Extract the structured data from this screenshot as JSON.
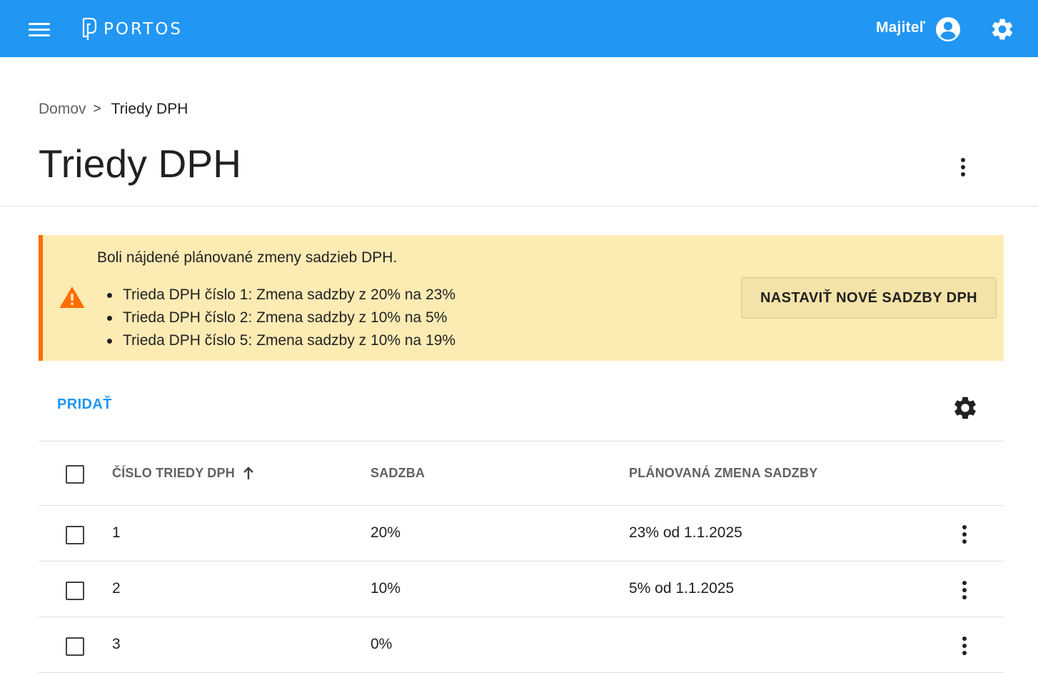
{
  "app": {
    "brand": "PORTOS",
    "user_label": "Majiteľ",
    "brand_color": "#2196f3",
    "icons": [
      "menu-icon",
      "portos-logo-icon",
      "account-circle-icon",
      "gear-icon"
    ]
  },
  "breadcrumb": {
    "home": "Domov",
    "separator": ">",
    "current": "Triedy DPH"
  },
  "page": {
    "title": "Triedy DPH"
  },
  "alert": {
    "title": "Boli nájdené plánované zmeny sadzieb DPH.",
    "items": [
      "Trieda DPH číslo 1: Zmena sadzby z 20% na 23%",
      "Trieda DPH číslo 2: Zmena sadzby z 10% na 5%",
      "Trieda DPH číslo 5: Zmena sadzby z 10% na 19%"
    ],
    "button_label": "NASTAVIŤ NOVÉ SADZBY DPH",
    "background_color": "#fdebb4",
    "accent_color": "#ff6d00"
  },
  "toolbar": {
    "add_label": "PRIDAŤ"
  },
  "table": {
    "columns": [
      "ČÍSLO TRIEDY DPH",
      "SADZBA",
      "PLÁNOVANÁ ZMENA SADZBY"
    ],
    "sort": {
      "column": "ČÍSLO TRIEDY DPH",
      "direction": "ascending"
    },
    "rows": [
      {
        "number": "1",
        "rate": "20%",
        "planned": "23% od 1.1.2025",
        "checked": false
      },
      {
        "number": "2",
        "rate": "10%",
        "planned": "5% od 1.1.2025",
        "checked": false
      },
      {
        "number": "3",
        "rate": "0%",
        "planned": "",
        "checked": false
      }
    ]
  }
}
